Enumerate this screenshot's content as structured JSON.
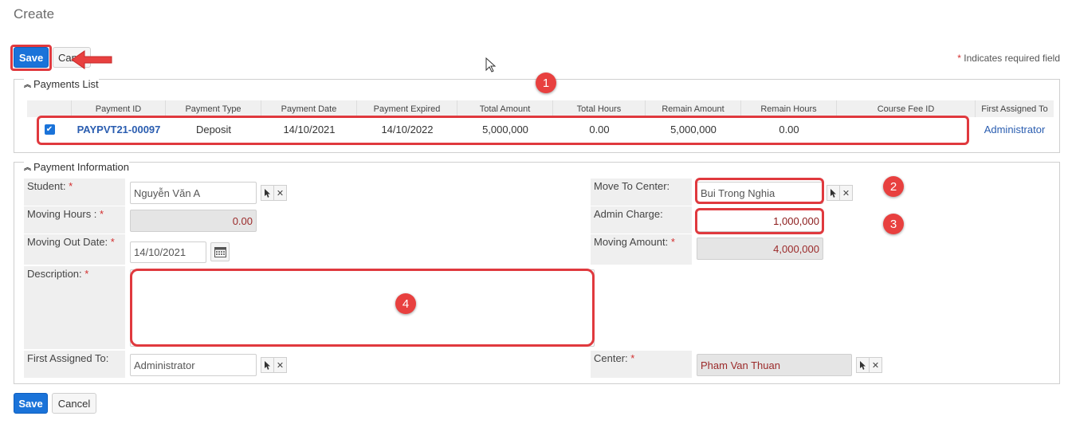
{
  "page": {
    "title": "Create"
  },
  "toolbar": {
    "save_label": "Save",
    "cancel_label": "Cancel",
    "cancel_clipped": "Can"
  },
  "required_note": {
    "star": "*",
    "text": " Indicates required field"
  },
  "payments_list": {
    "title": "Payments List",
    "columns": [
      "Payment ID",
      "Payment Type",
      "Payment Date",
      "Payment Expired",
      "Total Amount",
      "Total Hours",
      "Remain Amount",
      "Remain Hours",
      "Course Fee ID",
      "First Assigned To"
    ],
    "rows": [
      {
        "checked": true,
        "payment_id": "PAYPVT21-00097",
        "payment_type": "Deposit",
        "payment_date": "14/10/2021",
        "payment_expired": "14/10/2022",
        "total_amount": "5,000,000",
        "total_hours": "0.00",
        "remain_amount": "5,000,000",
        "remain_hours": "0.00",
        "course_fee_id": "",
        "first_assigned_to": "Administrator"
      }
    ]
  },
  "payment_info": {
    "title": "Payment Information",
    "student": {
      "label": "Student:",
      "value": "Nguyễn Văn A"
    },
    "moving_hours": {
      "label": "Moving Hours :",
      "value": "0.00"
    },
    "moving_out_date": {
      "label": "Moving Out Date:",
      "value": "14/10/2021"
    },
    "description": {
      "label": "Description:",
      "value": ""
    },
    "first_assigned_to": {
      "label": "First Assigned To:",
      "value": "Administrator"
    },
    "move_to_center": {
      "label": "Move To Center:",
      "value": "Bui Trong Nghia"
    },
    "admin_charge": {
      "label": "Admin Charge:",
      "value": "1,000,000"
    },
    "moving_amount": {
      "label": "Moving Amount:",
      "value": "4,000,000"
    },
    "center": {
      "label": "Center:",
      "value": "Pham Van Thuan"
    },
    "required_star": "*"
  },
  "footer": {
    "save_label": "Save",
    "cancel_label": "Cancel"
  },
  "annotations": [
    "1",
    "2",
    "3",
    "4"
  ],
  "icons": {
    "select": "cursor-arrow-icon",
    "clear": "x-icon",
    "calendar": "calendar-icon",
    "collapse": "double-chevron-up-icon",
    "check": "✔",
    "x": "✕"
  },
  "colors": {
    "primary": "#1a73d9",
    "annotation": "#e0393e",
    "link": "#2a5db0",
    "required": "#d32f2f"
  }
}
